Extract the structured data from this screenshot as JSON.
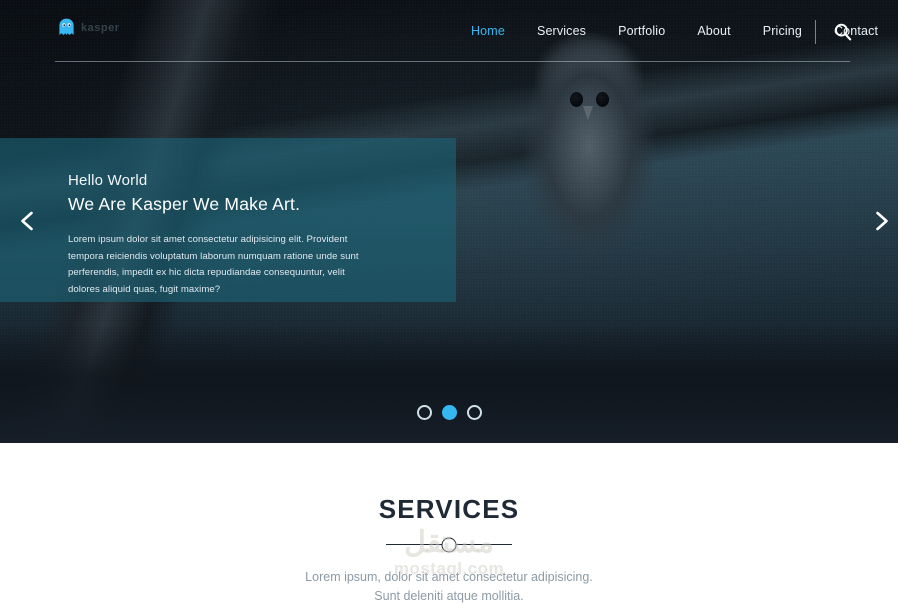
{
  "header": {
    "logo": {
      "icon": "ghost-icon",
      "word": "kasper"
    },
    "nav": [
      {
        "label": "Home",
        "active": true
      },
      {
        "label": "Services",
        "active": false
      },
      {
        "label": "Portfolio",
        "active": false
      },
      {
        "label": "About",
        "active": false
      },
      {
        "label": "Pricing",
        "active": false
      },
      {
        "label": "Contact",
        "active": false
      }
    ],
    "search_icon": "search-icon"
  },
  "hero": {
    "hello": "Hello World",
    "headline": "We Are Kasper We Make Art.",
    "body": "Lorem ipsum dolor sit amet consectetur adipisicing elit. Provident tempora reiciendis voluptatum laborum numquam ratione unde sunt perferendis, impedit ex hic dicta repudiandae consequuntur, velit dolores aliquid quas, fugit maxime?",
    "prev_icon": "chevron-left-icon",
    "next_icon": "chevron-right-icon",
    "bullets": [
      {
        "active": false
      },
      {
        "active": true
      },
      {
        "active": false
      }
    ]
  },
  "services": {
    "title": "SERVICES",
    "subtitle_line1": "Lorem ipsum, dolor sit amet consectetur adipisicing.",
    "subtitle_line2": "Sunt deleniti atque mollitia."
  },
  "watermark": {
    "arabic": "مستقل",
    "latin": "mostaql.com"
  },
  "colors": {
    "accent": "#35b8f0",
    "nav_active": "#3ab6f0",
    "panel": "rgba(28,100,120,0.62)",
    "dark": "#1f2a36",
    "muted": "#8d9aa5"
  }
}
